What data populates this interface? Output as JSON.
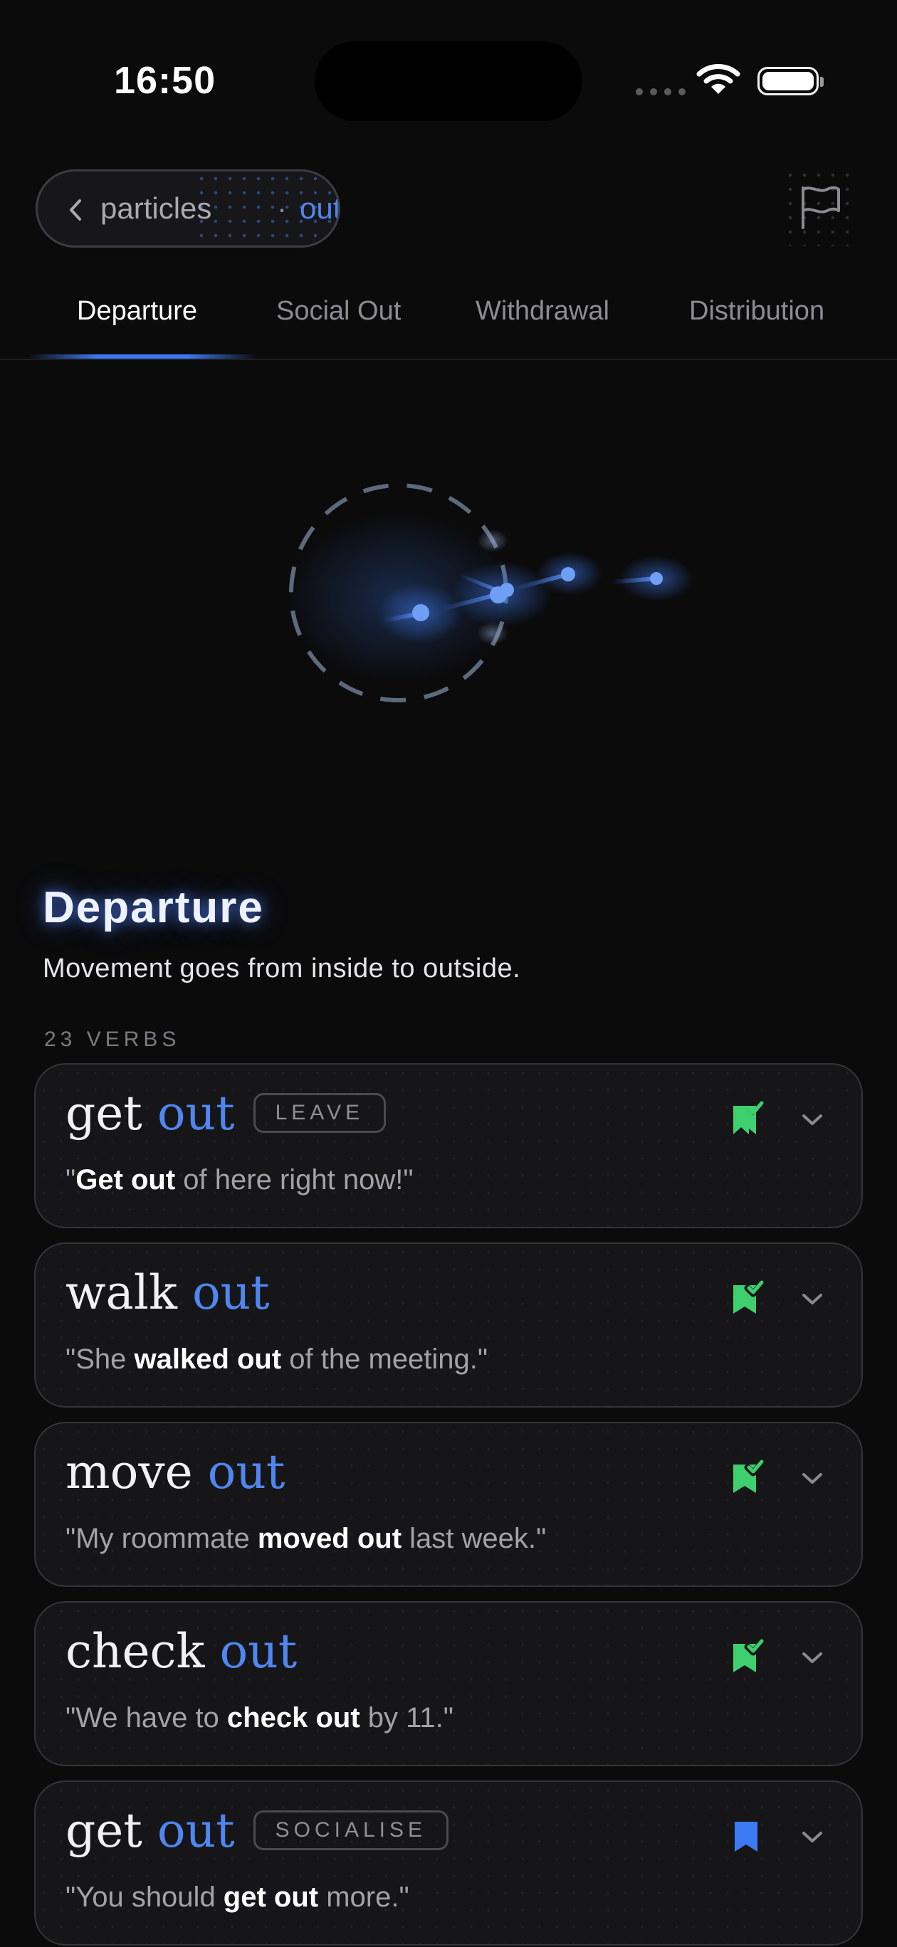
{
  "status_bar": {
    "time": "16:50"
  },
  "breadcrumb": {
    "parent": "particles",
    "separator": "·",
    "current": "out"
  },
  "tabs": [
    {
      "label": "Departure",
      "selected": true
    },
    {
      "label": "Social Out",
      "selected": false
    },
    {
      "label": "Withdrawal",
      "selected": false
    },
    {
      "label": "Distribution",
      "selected": false
    }
  ],
  "section": {
    "title": "Departure",
    "description": "Movement goes from inside to outside.",
    "count_label": "23 VERBS"
  },
  "cards": [
    {
      "base": "get",
      "particle": "out",
      "tag": "LEAVE",
      "example_pre": "\"",
      "example_bold": "Get out",
      "example_post": " of here right now!\"",
      "bookmark": "learned-bookmark-icon"
    },
    {
      "base": "walk",
      "particle": "out",
      "tag": "",
      "example_pre": "\"She ",
      "example_bold": "walked out",
      "example_post": " of the meeting.\"",
      "bookmark": "learned-bookmark-icon"
    },
    {
      "base": "move",
      "particle": "out",
      "tag": "",
      "example_pre": "\"My roommate ",
      "example_bold": "moved out",
      "example_post": " last week.\"",
      "bookmark": "learned-bookmark-icon"
    },
    {
      "base": "check",
      "particle": "out",
      "tag": "",
      "example_pre": "\"We have to ",
      "example_bold": "check out",
      "example_post": " by 11.\"",
      "bookmark": "learned-bookmark-icon"
    },
    {
      "base": "get",
      "particle": "out",
      "tag": "SOCIALISE",
      "example_pre": "\"You should ",
      "example_bold": "get out",
      "example_post": " more.\"",
      "bookmark": "saved-bookmark-icon"
    }
  ],
  "colors": {
    "accent": "#4f86f0",
    "learned": "#3ecf6e",
    "saved": "#3b7cf5",
    "background": "#0b0b0c"
  }
}
